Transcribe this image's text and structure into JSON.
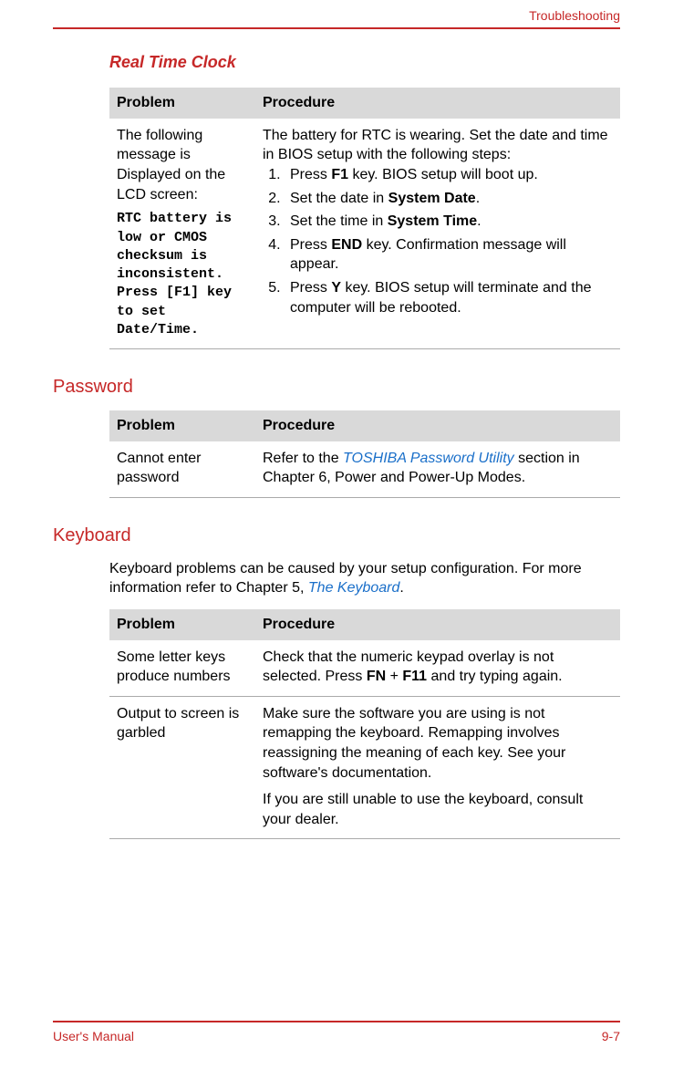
{
  "header": {
    "crumb": "Troubleshooting"
  },
  "sec_rtc": {
    "title": "Real Time Clock"
  },
  "th": {
    "problem": "Problem",
    "procedure": "Procedure"
  },
  "rtc": {
    "prob_intro": "The following message is Displayed on the LCD screen:",
    "prob_msg": "RTC battery is low or CMOS checksum is inconsistent. Press [F1] key to set Date/Time.",
    "proc_intro": "The battery for RTC is wearing. Set the date and time in BIOS setup with the following steps:",
    "s1a": "Press ",
    "s1b": "F1",
    "s1c": " key. BIOS setup will boot up.",
    "s2a": "Set the date in ",
    "s2b": "System Date",
    "s2c": ".",
    "s3a": "Set the time in ",
    "s3b": "System Time",
    "s3c": ".",
    "s4a": "Press ",
    "s4b": "END",
    "s4c": " key. Confirmation message will appear.",
    "s5a": "Press ",
    "s5b": "Y",
    "s5c": " key. BIOS setup will terminate and the computer will be rebooted."
  },
  "sec_pw": {
    "title": "Password"
  },
  "pw": {
    "prob": "Cannot enter password",
    "proc_a": "Refer to the ",
    "proc_link": "TOSHIBA Password Utility",
    "proc_b": " section in Chapter 6, Power and Power-Up Modes."
  },
  "sec_kb": {
    "title": "Keyboard",
    "intro_a": "Keyboard problems can be caused by your setup configuration. For more information refer to Chapter 5, ",
    "intro_link": "The Keyboard",
    "intro_b": "."
  },
  "kb1": {
    "prob": "Some letter keys produce numbers",
    "a": "Check that the numeric keypad overlay is not selected. Press ",
    "b1": "FN",
    "plus": " + ",
    "b2": "F11",
    "c": " and try typing again."
  },
  "kb2": {
    "prob": "Output to screen is garbled",
    "p1": "Make sure the software you are using is not remapping the keyboard. Remapping involves reassigning the meaning of each key. See your software's documentation.",
    "p2": "If you are still unable to use the keyboard, consult your dealer."
  },
  "footer": {
    "left": "User's Manual",
    "right": "9-7"
  }
}
